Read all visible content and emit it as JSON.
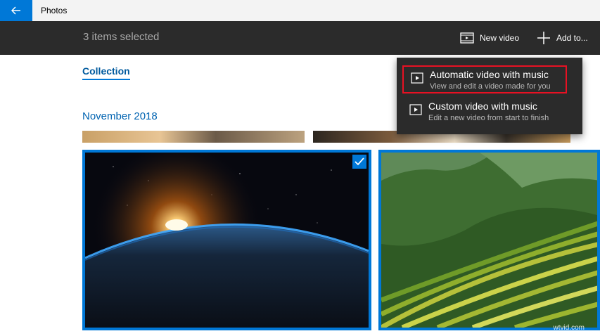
{
  "app": {
    "title": "Photos"
  },
  "command_bar": {
    "selection_text": "3 items selected",
    "new_video_label": "New video",
    "add_to_label": "Add to..."
  },
  "pivot": {
    "active_label": "Collection"
  },
  "group": {
    "heading": "November 2018"
  },
  "menu": {
    "items": [
      {
        "title": "Automatic video with music",
        "subtitle": "View and edit a video made for you"
      },
      {
        "title": "Custom video with music",
        "subtitle": "Edit a new video from start to finish"
      }
    ]
  },
  "tiles": [
    {
      "description": "earth-sunrise-photo",
      "selected": true
    },
    {
      "description": "rice-terraces-photo",
      "selected": false
    }
  ],
  "colors": {
    "accent": "#0078d7",
    "command_bar": "#2b2b2b",
    "highlight_outline": "#e81123"
  },
  "watermark": "wtvid.com"
}
